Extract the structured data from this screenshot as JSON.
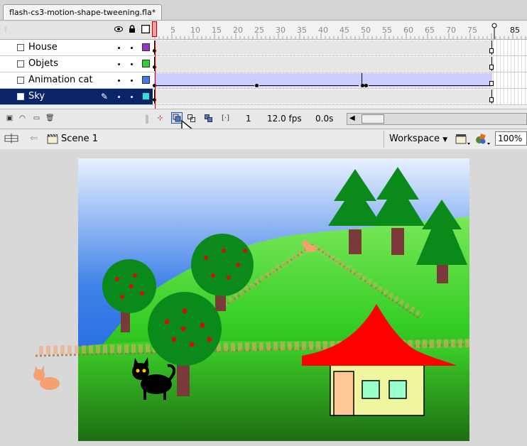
{
  "document": {
    "tab_title": "flash-cs3-motion-shape-tweening.fla*"
  },
  "timeline": {
    "header_icons": [
      "eye-icon",
      "lock-icon",
      "outline-icon"
    ],
    "ruler_ticks": [
      "5",
      "10",
      "15",
      "20",
      "25",
      "30",
      "35",
      "40",
      "45",
      "50",
      "55",
      "60",
      "65",
      "70",
      "75",
      "85"
    ],
    "layers": [
      {
        "name": "House",
        "color": "#9933cc",
        "selected": false
      },
      {
        "name": "Objets",
        "color": "#33cc33",
        "selected": false
      },
      {
        "name": "Animation cat",
        "color": "#4477ee",
        "selected": false
      },
      {
        "name": "Sky",
        "color": "#33dddd",
        "selected": true
      }
    ],
    "footer": {
      "current_frame": "1",
      "frame_rate": "12.0 fps",
      "elapsed_time": "0.0s"
    }
  },
  "editbar": {
    "scene_name": "Scene 1",
    "workspace_label": "Workspace",
    "zoom": "100%"
  }
}
